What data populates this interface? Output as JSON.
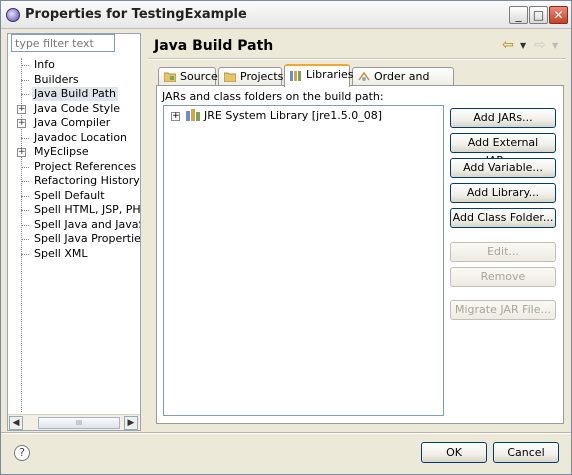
{
  "window": {
    "title": "Properties for TestingExample",
    "controls": {
      "minimize": "_",
      "maximize": "□",
      "close": "✕"
    }
  },
  "sidebar": {
    "filter_placeholder": "type filter text",
    "items": [
      {
        "label": "Info",
        "expandable": false,
        "selected": false
      },
      {
        "label": "Builders",
        "expandable": false,
        "selected": false
      },
      {
        "label": "Java Build Path",
        "expandable": false,
        "selected": true
      },
      {
        "label": "Java Code Style",
        "expandable": true,
        "selected": false
      },
      {
        "label": "Java Compiler",
        "expandable": true,
        "selected": false
      },
      {
        "label": "Javadoc Location",
        "expandable": false,
        "selected": false
      },
      {
        "label": "MyEclipse",
        "expandable": true,
        "selected": false
      },
      {
        "label": "Project References",
        "expandable": false,
        "selected": false
      },
      {
        "label": "Refactoring History",
        "expandable": false,
        "selected": false
      },
      {
        "label": "Spell Default",
        "expandable": false,
        "selected": false
      },
      {
        "label": "Spell HTML, JSP, PHP",
        "expandable": false,
        "selected": false
      },
      {
        "label": "Spell Java and JavaScript",
        "expandable": false,
        "selected": false
      },
      {
        "label": "Spell Java Properties",
        "expandable": false,
        "selected": false
      },
      {
        "label": "Spell XML",
        "expandable": false,
        "selected": false
      }
    ],
    "scroll_thumb_grip": "III"
  },
  "page": {
    "title": "Java Build Path",
    "tabs": [
      {
        "label": "Source",
        "icon": "source-folder-icon",
        "active": false
      },
      {
        "label": "Projects",
        "icon": "projects-folder-icon",
        "active": false
      },
      {
        "label": "Libraries",
        "icon": "libraries-icon",
        "active": true
      },
      {
        "label": "Order and Export",
        "icon": "order-export-icon",
        "active": false
      }
    ],
    "list_label": "JARs and class folders on the build path:",
    "libraries": [
      {
        "label": "JRE System Library [jre1.5.0_08]",
        "expander": "+"
      }
    ],
    "buttons": [
      {
        "label": "Add JARs...",
        "enabled": true
      },
      {
        "label": "Add External JARs...",
        "enabled": true
      },
      {
        "label": "Add Variable...",
        "enabled": true
      },
      {
        "label": "Add Library...",
        "enabled": true
      },
      {
        "label": "Add Class Folder...",
        "enabled": true
      },
      {
        "label": "Edit...",
        "enabled": false
      },
      {
        "label": "Remove",
        "enabled": false
      },
      {
        "label": "Migrate JAR File...",
        "enabled": false
      }
    ]
  },
  "footer": {
    "help": "?",
    "ok_label": "OK",
    "cancel_label": "Cancel"
  },
  "colors": {
    "dialog_bg": "#ece9d8",
    "active_tab_accent": "#f0a830",
    "button_border": "#003c74"
  }
}
